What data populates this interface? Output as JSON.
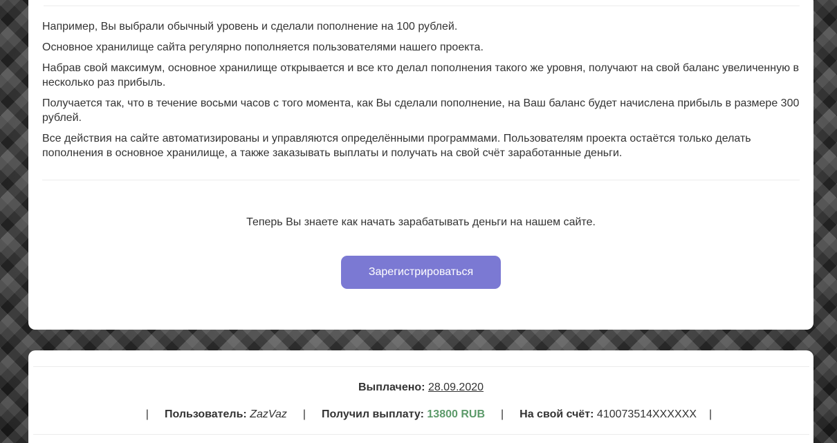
{
  "main": {
    "paragraphs": [
      "Например, Вы выбрали обычный уровень и сделали пополнение на 100 рублей.",
      "Основное хранилище сайта регулярно пополняется пользователями нашего проекта.",
      "Набрав свой максимум, основное хранилище открывается и все кто делал пополнения такого же уровня, получают на свой баланс увеличенную в несколько раз прибыль.",
      "Получается так, что в течение восьми часов с того момента, как Вы сделали пополнение, на Ваш баланс будет начислена прибыль в размере 300 рублей.",
      "Все действия на сайте автоматизированы и управляются определёнными программами. Пользователям проекта остаётся только делать пополнения в основное хранилище, а также заказывать выплаты и получать на свой счёт заработанные деньги."
    ],
    "cta_text": "Теперь Вы знаете как начать зарабатывать деньги на нашем сайте.",
    "register_button": "Зарегистрироваться"
  },
  "payout": {
    "paid_label": "Выплачено:",
    "paid_date": "28.09.2020",
    "separator": "|",
    "user_label": "Пользователь:",
    "user_value": "ZazVaz",
    "received_label": "Получил выплату:",
    "received_value": "13800 RUB",
    "account_label": "На свой счёт:",
    "account_value": "410073514XXXXXX"
  },
  "colors": {
    "button_bg": "#7b79d3",
    "amount_green": "#5c9a6a",
    "card_bg": "#ffffff"
  }
}
